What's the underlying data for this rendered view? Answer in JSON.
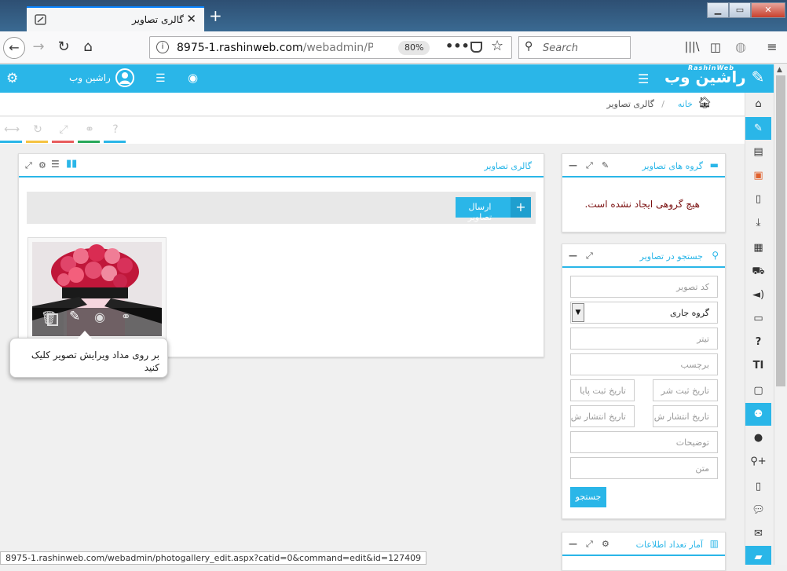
{
  "browser": {
    "tab_title": "گالری تصاویر",
    "url_host": "8975-1.rashinweb.com",
    "url_path": "/webadmin/Photo",
    "zoom": "80%",
    "search_placeholder": "Search",
    "status_url": "8975-1.rashinweb.com/webadmin/photogallery_edit.aspx?catid=0&command=edit&id=127409"
  },
  "header": {
    "logo_text": "راشین وب",
    "logo_small": "RashinWeb",
    "username": "راشین وب"
  },
  "breadcrumb": {
    "home": "خانه",
    "current": "گالری تصاویر"
  },
  "colors": {
    "accent": "#2ab6e8",
    "tool_bars": [
      "#2ab6e8",
      "#f5c342",
      "#e85c5c",
      "#27a85a",
      "#2ab6e8"
    ]
  },
  "gallery_panel": {
    "title": "گالری تصاویر",
    "upload_button": "ارسال تصاویر",
    "tooltip": "بر روی مداد ویرایش تصویر کلیک کنید"
  },
  "groups_panel": {
    "title": "گروه های تصاویر",
    "empty_message": "هیچ گروهی ایجاد نشده است."
  },
  "search_panel": {
    "title": "جستجو در تصاویر",
    "code_placeholder": "کد تصویر",
    "group_select": "گروه جاری",
    "title_placeholder": "تیتر",
    "tag_placeholder": "برچسب",
    "reg_start": "تاریخ ثبت شر",
    "reg_end": "تاریخ ثبت پایا",
    "pub_start": "تاریخ انتشار ش",
    "pub_end": "تاریخ انتشار ش",
    "desc_placeholder": "توضیحات",
    "text_placeholder": "متن",
    "search_button": "جستجو"
  },
  "stats_panel": {
    "title": "آمار تعداد اطلاعات"
  }
}
